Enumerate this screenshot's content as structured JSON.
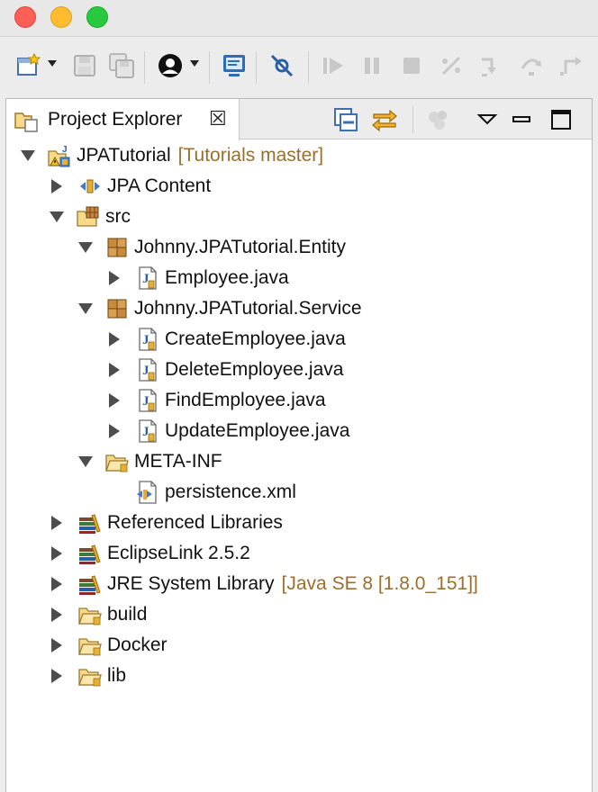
{
  "window": {
    "traffic_lights": {
      "close": "#fe5f57",
      "minimize": "#febc2e",
      "zoom": "#28c840"
    }
  },
  "toolbar": {
    "buttons": [
      "new-wizard",
      "save",
      "save-all",
      "person-perspective",
      "console",
      "skip-breakpoints",
      "resume",
      "suspend",
      "terminate",
      "disconnect",
      "step-into",
      "step-over",
      "step-return"
    ]
  },
  "view": {
    "tab_label": "Project Explorer",
    "close_glyph": "☒",
    "buttons": [
      "collapse-all",
      "link-with-editor",
      "focus-active-task",
      "view-menu",
      "minimize",
      "maximize"
    ]
  },
  "tree": [
    {
      "depth": 0,
      "state": "expanded",
      "icon": "java-project-icon",
      "label": "JPATutorial",
      "decoration": "[Tutorials master]"
    },
    {
      "depth": 1,
      "state": "collapsed",
      "icon": "jpa-content-icon",
      "label": "JPA Content"
    },
    {
      "depth": 1,
      "state": "expanded",
      "icon": "source-folder-icon",
      "label": "src"
    },
    {
      "depth": 2,
      "state": "expanded",
      "icon": "package-icon",
      "label": "Johnny.JPATutorial.Entity"
    },
    {
      "depth": 3,
      "state": "collapsed",
      "icon": "java-file-icon",
      "label": "Employee.java"
    },
    {
      "depth": 2,
      "state": "expanded",
      "icon": "package-icon",
      "label": "Johnny.JPATutorial.Service"
    },
    {
      "depth": 3,
      "state": "collapsed",
      "icon": "java-file-icon",
      "label": "CreateEmployee.java"
    },
    {
      "depth": 3,
      "state": "collapsed",
      "icon": "java-file-icon",
      "label": "DeleteEmployee.java"
    },
    {
      "depth": 3,
      "state": "collapsed",
      "icon": "java-file-icon",
      "label": "FindEmployee.java"
    },
    {
      "depth": 3,
      "state": "collapsed",
      "icon": "java-file-icon",
      "label": "UpdateEmployee.java"
    },
    {
      "depth": 2,
      "state": "expanded",
      "icon": "folder-icon",
      "label": "META-INF"
    },
    {
      "depth": 3,
      "state": "none",
      "icon": "xml-file-icon",
      "label": "persistence.xml"
    },
    {
      "depth": 1,
      "state": "collapsed",
      "icon": "library-icon",
      "label": "Referenced Libraries"
    },
    {
      "depth": 1,
      "state": "collapsed",
      "icon": "library-icon",
      "label": "EclipseLink 2.5.2"
    },
    {
      "depth": 1,
      "state": "collapsed",
      "icon": "library-icon",
      "label": "JRE System Library",
      "decoration": "[Java SE 8 [1.8.0_151]]"
    },
    {
      "depth": 1,
      "state": "collapsed",
      "icon": "folder-icon",
      "label": "build"
    },
    {
      "depth": 1,
      "state": "collapsed",
      "icon": "folder-icon",
      "label": "Docker"
    },
    {
      "depth": 1,
      "state": "collapsed",
      "icon": "folder-icon",
      "label": "lib"
    }
  ]
}
